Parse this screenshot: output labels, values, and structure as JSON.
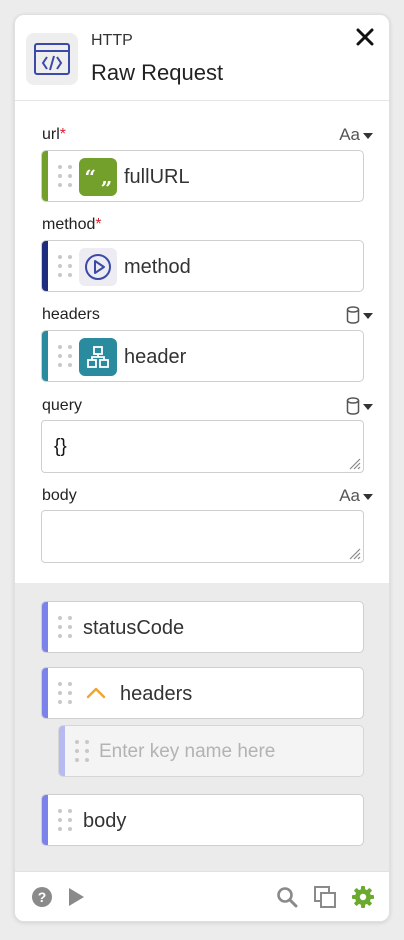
{
  "header": {
    "category": "HTTP",
    "title": "Raw Request",
    "icon": "code-window-icon",
    "close_icon": "close-icon"
  },
  "inputs": {
    "url": {
      "label": "url",
      "required_mark": "*",
      "type_selector": "Aa",
      "value": "fullURL",
      "chip_glyph": "“ „",
      "accent": "#72a02b"
    },
    "method": {
      "label": "method",
      "required_mark": "*",
      "value": "method",
      "accent": "#1e2d7d"
    },
    "headers": {
      "label": "headers",
      "type_icon": "database-icon",
      "value": "header",
      "accent": "#2a8a9e"
    },
    "query": {
      "label": "query",
      "type_icon": "database-icon",
      "value": "{}"
    },
    "body": {
      "label": "body",
      "type_selector": "Aa",
      "value": ""
    }
  },
  "outputs": {
    "statusCode": {
      "label": "statusCode"
    },
    "headers": {
      "label": "headers",
      "expand_icon": "chevron-up-icon"
    },
    "headers_key_placeholder": "Enter key name here",
    "body": {
      "label": "body"
    },
    "accent": "#7b83eb"
  },
  "footer": {
    "icons": [
      "help-icon",
      "run-icon",
      "search-icon",
      "duplicate-icon",
      "settings-icon"
    ],
    "settings_color": "#6aaa2e"
  }
}
